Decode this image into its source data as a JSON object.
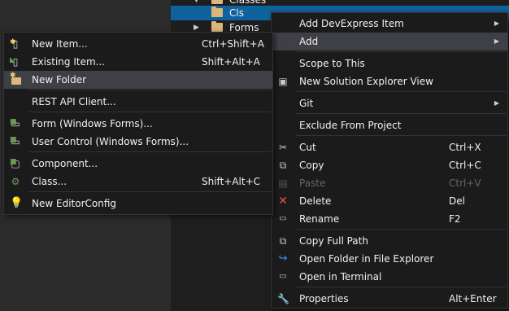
{
  "tree": {
    "items": [
      {
        "label": "Classes",
        "expanded": true
      },
      {
        "label": "Cls",
        "selected": true
      },
      {
        "label": "Forms",
        "expanded": false
      }
    ]
  },
  "main_menu": {
    "items": [
      {
        "label": "Add DevExpress Item",
        "shortcut": "",
        "submenu": true
      },
      {
        "label": "Add",
        "shortcut": "",
        "submenu": true
      },
      {
        "label": "Scope to This",
        "shortcut": ""
      },
      {
        "label": "New Solution Explorer View",
        "shortcut": "",
        "icon": "new-view-icon"
      },
      {
        "label": "Git",
        "shortcut": "",
        "submenu": true
      },
      {
        "label": "Exclude From Project",
        "shortcut": ""
      },
      {
        "label": "Cut",
        "shortcut": "Ctrl+X",
        "icon": "scissors-icon"
      },
      {
        "label": "Copy",
        "shortcut": "Ctrl+C",
        "icon": "copy-icon"
      },
      {
        "label": "Paste",
        "shortcut": "Ctrl+V",
        "icon": "paste-icon",
        "disabled": true
      },
      {
        "label": "Delete",
        "shortcut": "Del",
        "icon": "delete-icon"
      },
      {
        "label": "Rename",
        "shortcut": "F2",
        "icon": "rename-icon"
      },
      {
        "label": "Copy Full Path",
        "shortcut": "",
        "icon": "copy-path-icon"
      },
      {
        "label": "Open Folder in File Explorer",
        "shortcut": "",
        "icon": "open-folder-icon"
      },
      {
        "label": "Open in Terminal",
        "shortcut": "",
        "icon": "terminal-icon"
      },
      {
        "label": "Properties",
        "shortcut": "Alt+Enter",
        "icon": "wrench-icon"
      }
    ]
  },
  "sub_menu": {
    "items": [
      {
        "label": "New Item...",
        "shortcut": "Ctrl+Shift+A",
        "icon": "new-item-icon"
      },
      {
        "label": "Existing Item...",
        "shortcut": "Shift+Alt+A",
        "icon": "existing-item-icon"
      },
      {
        "label": "New Folder",
        "shortcut": "",
        "icon": "new-folder-icon",
        "hover": true
      },
      {
        "label": "REST API Client...",
        "shortcut": ""
      },
      {
        "label": "Form (Windows Forms)...",
        "shortcut": "",
        "icon": "form-icon"
      },
      {
        "label": "User Control (Windows Forms)...",
        "shortcut": "",
        "icon": "user-control-icon"
      },
      {
        "label": "Component...",
        "shortcut": "",
        "icon": "component-icon"
      },
      {
        "label": "Class...",
        "shortcut": "Shift+Alt+C",
        "icon": "class-icon"
      },
      {
        "label": "New EditorConfig",
        "shortcut": "",
        "icon": "editorconfig-icon"
      }
    ]
  }
}
